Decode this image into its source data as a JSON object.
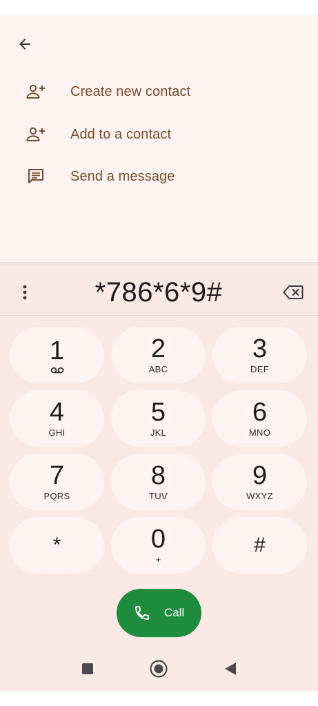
{
  "actions": [
    {
      "label": "Create new contact",
      "icon": "person-add-icon"
    },
    {
      "label": "Add to a contact",
      "icon": "person-add-icon"
    },
    {
      "label": "Send a message",
      "icon": "message-icon"
    }
  ],
  "dialer": {
    "number": "*786*6*9#",
    "keys": [
      {
        "digit": "1",
        "letters": "",
        "extra": "voicemail-icon"
      },
      {
        "digit": "2",
        "letters": "ABC"
      },
      {
        "digit": "3",
        "letters": "DEF"
      },
      {
        "digit": "4",
        "letters": "GHI"
      },
      {
        "digit": "5",
        "letters": "JKL"
      },
      {
        "digit": "6",
        "letters": "MNO"
      },
      {
        "digit": "7",
        "letters": "PQRS"
      },
      {
        "digit": "8",
        "letters": "TUV"
      },
      {
        "digit": "9",
        "letters": "WXYZ"
      },
      {
        "digit": "*",
        "letters": ""
      },
      {
        "digit": "0",
        "letters": "+"
      },
      {
        "digit": "#",
        "letters": ""
      }
    ],
    "call_label": "Call"
  },
  "colors": {
    "accent_text": "#7a4b2a",
    "call_green": "#1e8e3e",
    "panel_bg": "#fbe9e3",
    "key_bg": "#fff4f1"
  }
}
